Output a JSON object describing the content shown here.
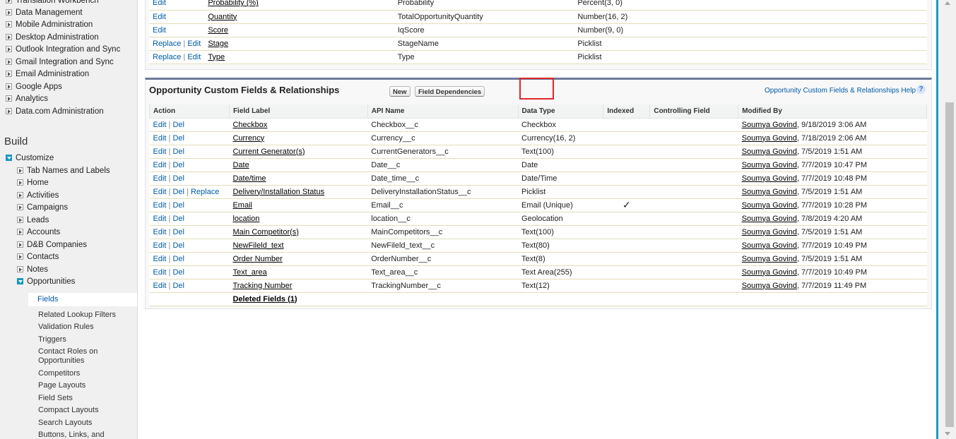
{
  "sidebar": {
    "admin_items": [
      {
        "label": "Translation Workbench"
      },
      {
        "label": "Data Management"
      },
      {
        "label": "Mobile Administration"
      },
      {
        "label": "Desktop Administration"
      },
      {
        "label": "Outlook Integration and Sync"
      },
      {
        "label": "Gmail Integration and Sync"
      },
      {
        "label": "Email Administration"
      },
      {
        "label": "Google Apps"
      },
      {
        "label": "Analytics"
      },
      {
        "label": "Data.com Administration"
      }
    ],
    "build_heading": "Build",
    "customize_label": "Customize",
    "customize_items": [
      {
        "label": "Tab Names and Labels"
      },
      {
        "label": "Home"
      },
      {
        "label": "Activities"
      },
      {
        "label": "Campaigns"
      },
      {
        "label": "Leads"
      },
      {
        "label": "Accounts"
      },
      {
        "label": "D&B Companies"
      },
      {
        "label": "Contacts"
      },
      {
        "label": "Notes"
      },
      {
        "label": "Opportunities"
      }
    ],
    "selected_item": "Fields",
    "opportunity_subitems": [
      {
        "label": "Related Lookup Filters"
      },
      {
        "label": "Validation Rules"
      },
      {
        "label": "Triggers"
      },
      {
        "label": "Contact Roles on"
      },
      {
        "label": "Opportunities"
      },
      {
        "label": "Competitors"
      },
      {
        "label": "Page Layouts"
      },
      {
        "label": "Field Sets"
      },
      {
        "label": "Compact Layouts"
      },
      {
        "label": "Search Layouts"
      },
      {
        "label": "Buttons, Links, and"
      }
    ]
  },
  "standard_fields": {
    "rows": [
      {
        "actions": [
          "Edit"
        ],
        "label": "Probability (%)",
        "api": "Probability",
        "type": "Percent(3, 0)"
      },
      {
        "actions": [
          "Edit"
        ],
        "label": "Quantity",
        "api": "TotalOpportunityQuantity",
        "type": "Number(16, 2)"
      },
      {
        "actions": [
          "Edit"
        ],
        "label": "Score",
        "api": "IqScore",
        "type": "Number(9, 0)"
      },
      {
        "actions": [
          "Replace",
          "Edit"
        ],
        "label": "Stage",
        "api": "StageName",
        "type": "Picklist"
      },
      {
        "actions": [
          "Replace",
          "Edit"
        ],
        "label": "Type",
        "api": "Type",
        "type": "Picklist"
      }
    ]
  },
  "custom_fields": {
    "title": "Opportunity Custom Fields & Relationships",
    "new_button": "New",
    "dependencies_button": "Field Dependencies",
    "help_link": "Opportunity Custom Fields & Relationships Help",
    "help_icon": "?",
    "columns": [
      "Action",
      "Field Label",
      "API Name",
      "Data Type",
      "Indexed",
      "Controlling Field",
      "Modified By"
    ],
    "rows": [
      {
        "actions": [
          "Edit",
          "Del"
        ],
        "label": "Checkbox",
        "api": "Checkbox__c",
        "type": "Checkbox",
        "indexed": "",
        "controlling": "",
        "user": "Soumya Govind",
        "date": ", 9/18/2019 3:06 AM"
      },
      {
        "actions": [
          "Edit",
          "Del"
        ],
        "label": "Currency",
        "api": "Currency__c",
        "type": "Currency(16, 2)",
        "indexed": "",
        "controlling": "",
        "user": "Soumya Govind",
        "date": ", 7/18/2019 2:06 AM"
      },
      {
        "actions": [
          "Edit",
          "Del"
        ],
        "label": "Current Generator(s)",
        "api": "CurrentGenerators__c",
        "type": "Text(100)",
        "indexed": "",
        "controlling": "",
        "user": "Soumya Govind",
        "date": ", 7/5/2019 1:51 AM"
      },
      {
        "actions": [
          "Edit",
          "Del"
        ],
        "label": "Date",
        "api": "Date__c",
        "type": "Date",
        "indexed": "",
        "controlling": "",
        "user": "Soumya Govind",
        "date": ", 7/7/2019 10:47 PM"
      },
      {
        "actions": [
          "Edit",
          "Del"
        ],
        "label": "Date/time",
        "api": "Date_time__c",
        "type": "Date/Time",
        "indexed": "",
        "controlling": "",
        "user": "Soumya Govind",
        "date": ", 7/7/2019 10:48 PM"
      },
      {
        "actions": [
          "Edit",
          "Del",
          "Replace"
        ],
        "label": "Delivery/Installation Status",
        "api": "DeliveryInstallationStatus__c",
        "type": "Picklist",
        "indexed": "",
        "controlling": "",
        "user": "Soumya Govind",
        "date": ", 7/5/2019 1:51 AM"
      },
      {
        "actions": [
          "Edit",
          "Del"
        ],
        "label": "Email",
        "api": "Email__c",
        "type": "Email (Unique)",
        "indexed": "✓",
        "controlling": "",
        "user": "Soumya Govind",
        "date": ", 7/7/2019 10:28 PM"
      },
      {
        "actions": [
          "Edit",
          "Del"
        ],
        "label": "location",
        "api": "location__c",
        "type": "Geolocation",
        "indexed": "",
        "controlling": "",
        "user": "Soumya Govind",
        "date": ", 7/8/2019 4:20 AM"
      },
      {
        "actions": [
          "Edit",
          "Del"
        ],
        "label": "Main Competitor(s)",
        "api": "MainCompetitors__c",
        "type": "Text(100)",
        "indexed": "",
        "controlling": "",
        "user": "Soumya Govind",
        "date": ", 7/5/2019 1:51 AM"
      },
      {
        "actions": [
          "Edit",
          "Del"
        ],
        "label": "NewFileld_text",
        "api": "NewFileld_text__c",
        "type": "Text(80)",
        "indexed": "",
        "controlling": "",
        "user": "Soumya Govind",
        "date": ", 7/7/2019 10:49 PM"
      },
      {
        "actions": [
          "Edit",
          "Del"
        ],
        "label": "Order Number",
        "api": "OrderNumber__c",
        "type": "Text(8)",
        "indexed": "",
        "controlling": "",
        "user": "Soumya Govind",
        "date": ", 7/5/2019 1:51 AM"
      },
      {
        "actions": [
          "Edit",
          "Del"
        ],
        "label": "Text_area",
        "api": "Text_area__c",
        "type": "Text Area(255)",
        "indexed": "",
        "controlling": "",
        "user": "Soumya Govind",
        "date": ", 7/7/2019 10:49 PM"
      },
      {
        "actions": [
          "Edit",
          "Del"
        ],
        "label": "Tracking Number",
        "api": "TrackingNumber__c",
        "type": "Text(12)",
        "indexed": "",
        "controlling": "",
        "user": "Soumya Govind",
        "date": ", 7/7/2019 11:49 PM"
      }
    ],
    "deleted_fields_link": "Deleted Fields (1)"
  },
  "colors": {
    "link": "#015ba7",
    "highlight_border": "#e0262b",
    "panel_header_border": "#6b7a99",
    "scrollbar_accent": "#1a9ac9"
  }
}
